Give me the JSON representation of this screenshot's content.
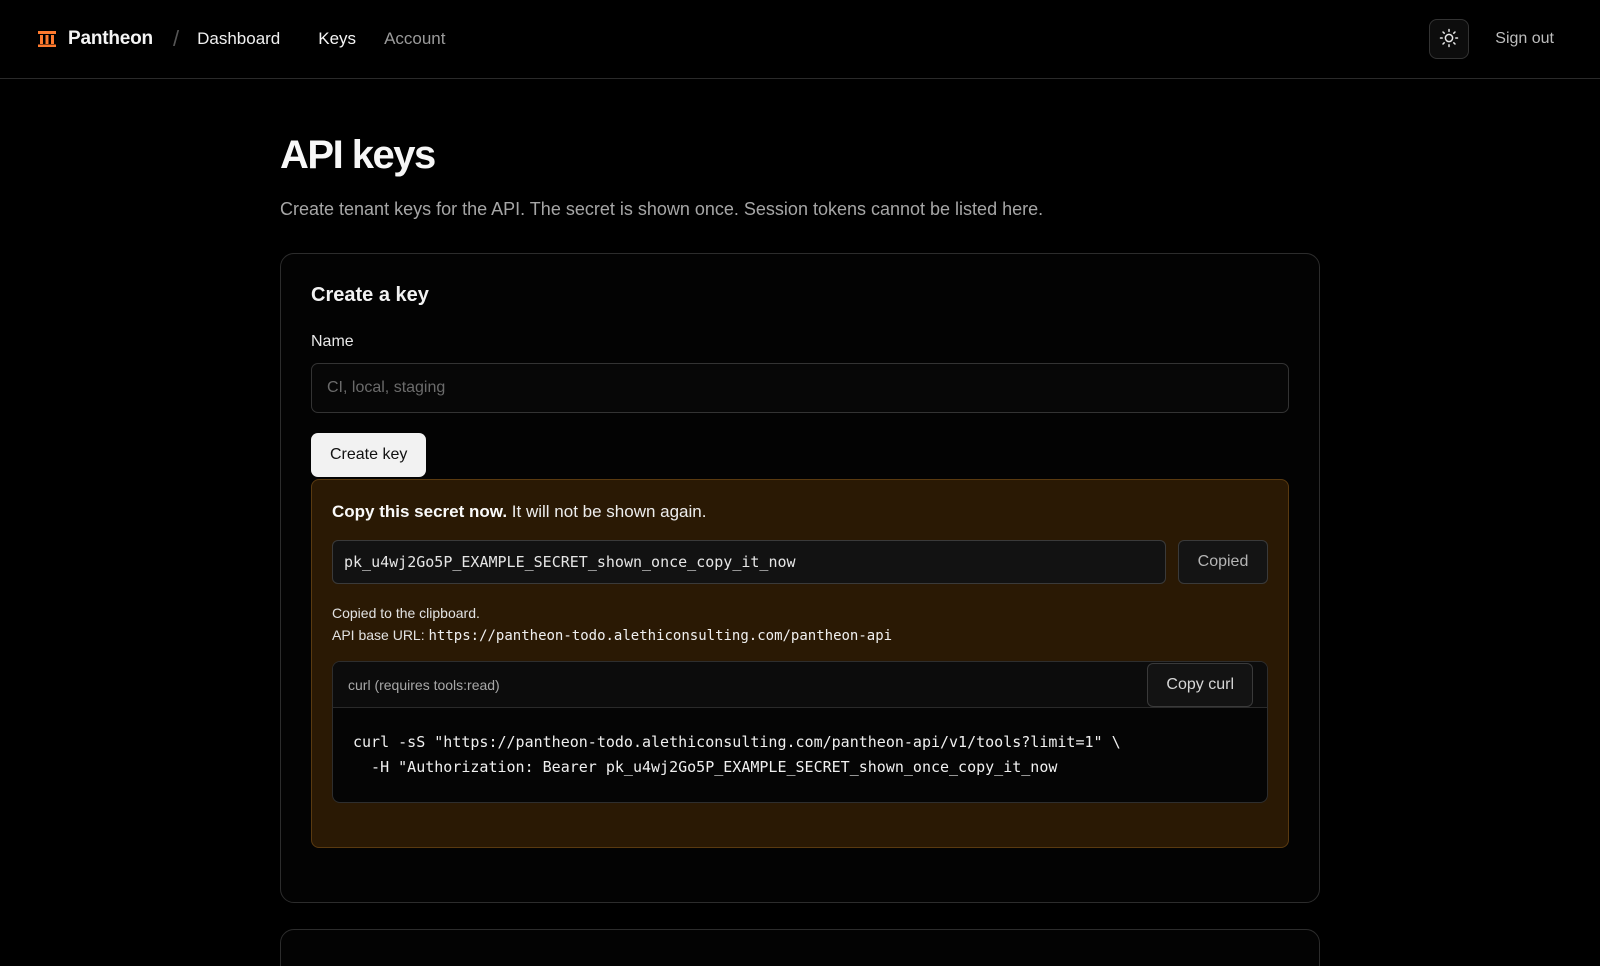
{
  "header": {
    "brand": "Pantheon",
    "separator": "/",
    "crumb": "Dashboard",
    "nav": [
      {
        "label": "Keys",
        "active": true
      },
      {
        "label": "Account",
        "active": false
      }
    ],
    "theme_icon": "sun-icon",
    "signout": "Sign out",
    "brand_color": "#ff7a2e"
  },
  "page": {
    "title": "API keys",
    "subtitle": "Create tenant keys for the API. The secret is shown once. Session tokens cannot be listed here."
  },
  "create_card": {
    "title": "Create a key",
    "name_label": "Name",
    "name_placeholder": "CI, local, staging",
    "name_value": "",
    "create_button": "Create key"
  },
  "secret": {
    "heading_bold": "Copy this secret now.",
    "heading_rest": " It will not be shown again.",
    "value": "pk_u4wj2Go5P_EXAMPLE_SECRET_shown_once_copy_it_now",
    "copy_button": "Copied",
    "copied_note": "Copied to the clipboard.",
    "base_url_label": "API base URL: ",
    "base_url": "https://pantheon-todo.alethiconsulting.com/pantheon-api"
  },
  "curl": {
    "label": "curl (requires tools:read)",
    "copy_button": "Copy curl",
    "code": "curl -sS \"https://pantheon-todo.alethiconsulting.com/pantheon-api/v1/tools?limit=1\" \\\n  -H \"Authorization: Bearer pk_u4wj2Go5P_EXAMPLE_SECRET_shown_once_copy_it_now"
  },
  "colors": {
    "background": "#000000",
    "secret_bg": "#2a1904",
    "secret_border": "#5a3a10"
  }
}
